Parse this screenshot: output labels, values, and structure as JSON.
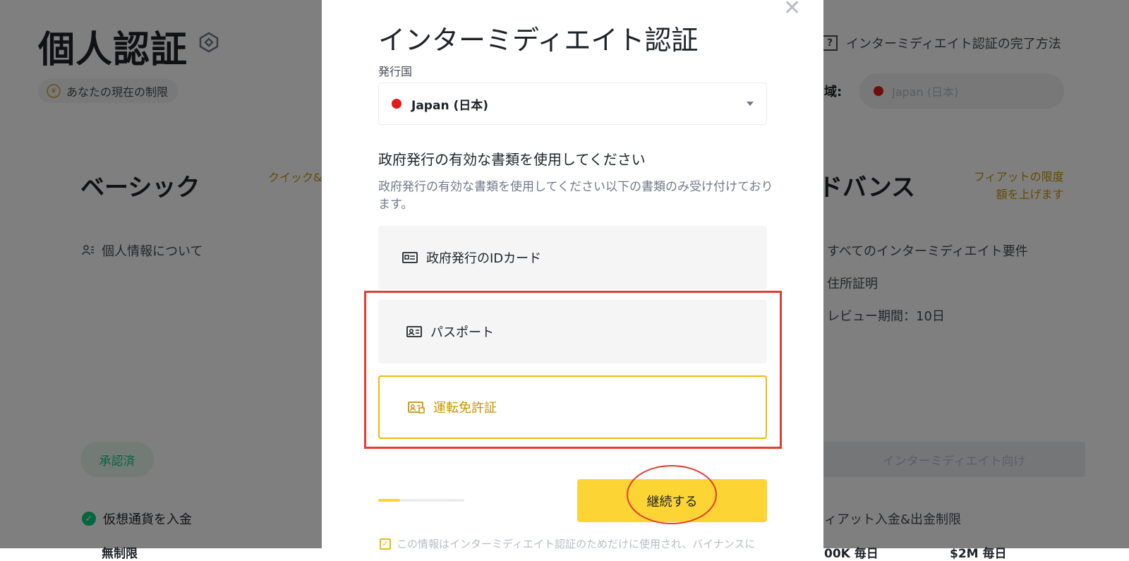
{
  "background": {
    "page_title": "個人認証",
    "limit_chip": "あなたの現在の制限",
    "howto_link": "インターミディエイト認証の完了方法",
    "region_label": "域:",
    "region_value": "Japan (日本)",
    "basic": {
      "title": "ベーシック",
      "quick_link": "クイック&",
      "requirement": "個人情報について",
      "status_badge": "承認済",
      "deposit": "仮想通貨を入金",
      "cut_text": "無制限"
    },
    "advanced": {
      "title": "ドバンス",
      "note_line1": "フィアットの限度",
      "note_line2": "額を上げます",
      "requirements": [
        "すべてのインターミディエイト要件",
        "住所証明",
        "レビュー期間：10日"
      ],
      "button_label": "インターミディエイト向け",
      "fiat_row": "ィアット入金&出金制限",
      "cut_text_1": "00K 毎日",
      "cut_text_2": "$2M 毎日"
    }
  },
  "modal": {
    "title": "インターミディエイト認証",
    "country_label": "発行国",
    "country_value": "Japan (日本)",
    "doc_heading": "政府発行の有効な書類を使用してください",
    "doc_description": "政府発行の有効な書類を使用してください以下の書類のみ受け付けております。",
    "options": [
      {
        "label": "政府発行のIDカード",
        "icon": "id-card-icon",
        "selected": false
      },
      {
        "label": "パスポート",
        "icon": "passport-icon",
        "selected": false
      },
      {
        "label": "運転免許証",
        "icon": "drivers-license-icon",
        "selected": true
      }
    ],
    "progress": 0.25,
    "continue_label": "継続する",
    "consent_text": "この情報はインターミディエイト認証のためだけに使用され、バイナンスに"
  },
  "colors": {
    "accent_yellow": "#fcd535",
    "selected_border": "#f0b90b",
    "highlight_red": "#e63b2e",
    "success_green": "#0ecb81"
  }
}
